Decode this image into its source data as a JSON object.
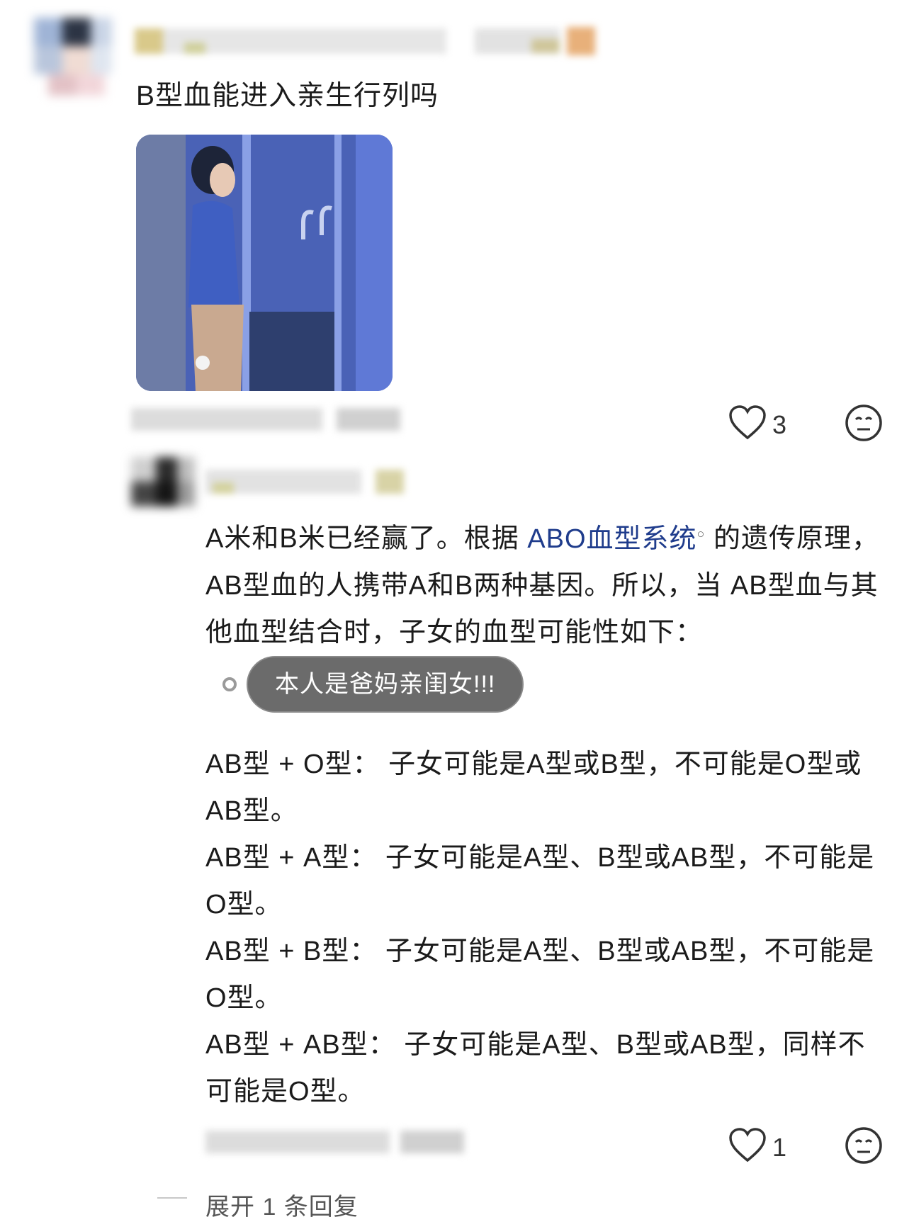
{
  "comment1": {
    "text": "B型血能进入亲生行列吗",
    "likes": "3"
  },
  "reply": {
    "intro_before_link": "A米和B米已经赢了。根据 ",
    "link_text": "ABO血型系统",
    "intro_after_link": " 的遗传原理，AB型血的人携带A和B两种基因。所以，当 AB型血与其他血型结合时，子女的血型可能性如下：",
    "annotation": "本人是爸妈亲闺女!!!",
    "lines": [
      "AB型 + O型： 子女可能是A型或B型，不可能是O型或AB型。",
      "AB型 + A型： 子女可能是A型、B型或AB型，不可能是O型。",
      "AB型 + B型： 子女可能是A型、B型或AB型，不可能是O型。",
      "AB型 + AB型： 子女可能是A型、B型或AB型，同样不可能是O型。"
    ],
    "likes": "1"
  },
  "expand": {
    "label": "展开 1 条回复"
  },
  "icons": {
    "like": "heart-outline-icon",
    "react": "neutral-face-icon",
    "search": "search-icon"
  },
  "colors": {
    "link": "#1f3c8c",
    "annotation_bg": "#6b6b6b"
  }
}
